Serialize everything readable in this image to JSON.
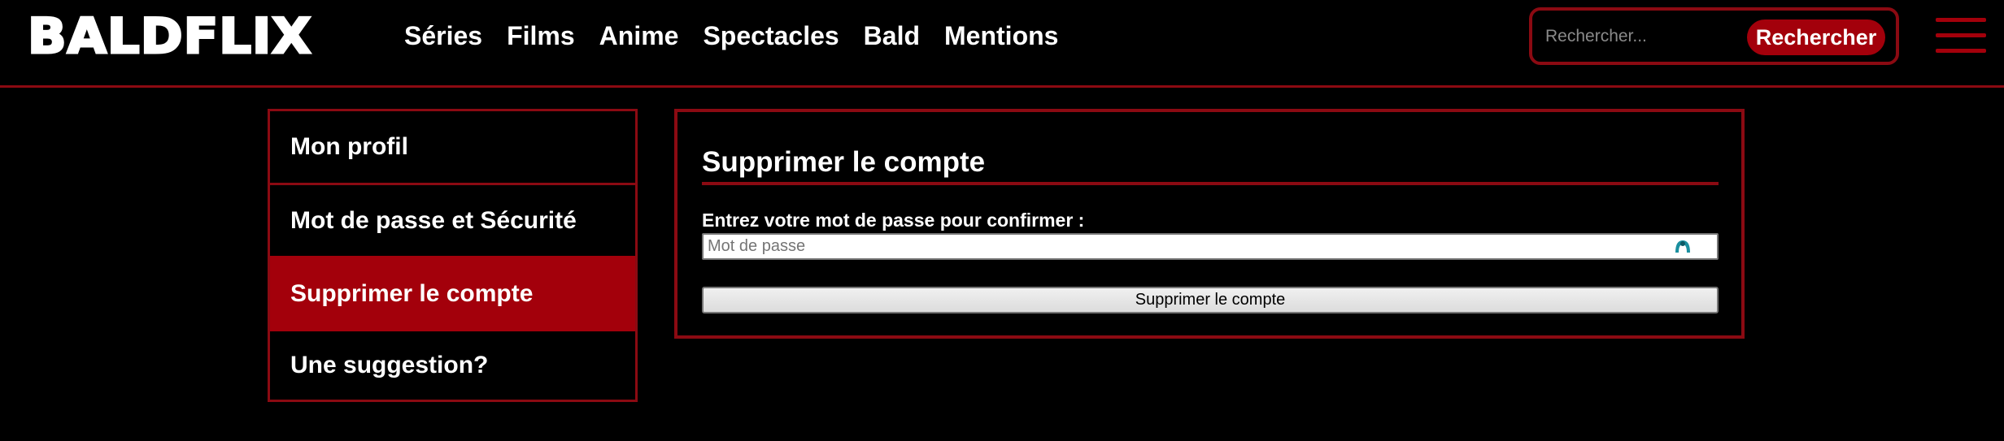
{
  "header": {
    "logo": "BALDFLIX",
    "nav": [
      "Séries",
      "Films",
      "Anime",
      "Spectacles",
      "Bald",
      "Mentions"
    ],
    "search": {
      "placeholder": "Rechercher...",
      "button_label": "Rechercher"
    },
    "menu_icon": "hamburger-menu-icon"
  },
  "sidebar": {
    "items": [
      {
        "label": "Mon profil",
        "active": false
      },
      {
        "label": "Mot de passe et Sécurité",
        "active": false
      },
      {
        "label": "Supprimer le compte",
        "active": true
      },
      {
        "label": "Une suggestion?",
        "active": false
      }
    ]
  },
  "main": {
    "title": "Supprimer le compte",
    "password_label": "Entrez votre mot de passe pour confirmer :",
    "password_placeholder": "Mot de passe",
    "password_value": "",
    "password_manager_icon": "password-manager-icon",
    "submit_label": "Supprimer le compte"
  },
  "colors": {
    "background": "#000000",
    "accent": "#a3000b",
    "border": "#8b0a12",
    "text": "#ffffff"
  }
}
